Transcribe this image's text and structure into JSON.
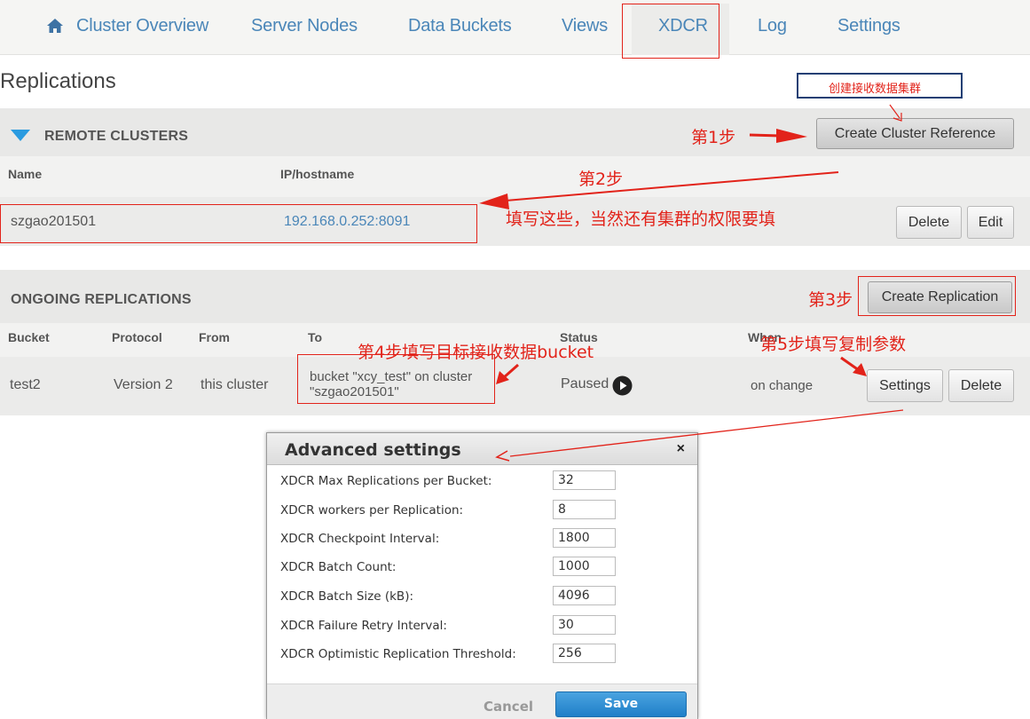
{
  "nav": {
    "items": [
      "Cluster Overview",
      "Server Nodes",
      "Data Buckets",
      "Views",
      "XDCR",
      "Log",
      "Settings"
    ],
    "active": "XDCR"
  },
  "page": {
    "title": "Replications"
  },
  "remote_clusters": {
    "title": "REMOTE CLUSTERS",
    "create_button": "Create Cluster Reference",
    "columns": {
      "name": "Name",
      "ip": "IP/hostname"
    },
    "row": {
      "name": "szgao201501",
      "ip": "192.168.0.252:8091"
    },
    "delete_button": "Delete",
    "edit_button": "Edit"
  },
  "ongoing_replications": {
    "title": "ONGOING REPLICATIONS",
    "create_button": "Create Replication",
    "columns": {
      "bucket": "Bucket",
      "protocol": "Protocol",
      "from": "From",
      "to": "To",
      "status": "Status",
      "when": "When"
    },
    "row": {
      "bucket": "test2",
      "protocol": "Version 2",
      "from": "this cluster",
      "to_line1": "bucket \"xcy_test\" on cluster",
      "to_line2": "\"szgao201501\"",
      "status": "Paused",
      "when": "on change"
    },
    "settings_button": "Settings",
    "delete_button": "Delete"
  },
  "annotations": {
    "create_cluster_hint": "创建接收数据集群",
    "step1": "第1步",
    "step2": "第2步",
    "step2_detail": "填写这些，当然还有集群的权限要填",
    "step3": "第3步",
    "step4": "第4步填写目标接收数据bucket",
    "step5": "第5步填写复制参数"
  },
  "dialog": {
    "title": "Advanced settings",
    "close": "×",
    "settings": [
      {
        "label": "XDCR Max Replications per Bucket:",
        "value": "32"
      },
      {
        "label": "XDCR workers per Replication:",
        "value": "8"
      },
      {
        "label": "XDCR Checkpoint Interval:",
        "value": "1800"
      },
      {
        "label": "XDCR Batch Count:",
        "value": "1000"
      },
      {
        "label": "XDCR Batch Size (kB):",
        "value": "4096"
      },
      {
        "label": "XDCR Failure Retry Interval:",
        "value": "30"
      },
      {
        "label": "XDCR Optimistic Replication Threshold:",
        "value": "256"
      }
    ],
    "cancel": "Cancel",
    "save": "Save"
  },
  "colors": {
    "nav_link": "#4a86b8",
    "annotation_red": "#e2231a",
    "panel_bg": "#f2f2f1",
    "save_blue": "#2b8fd6"
  }
}
